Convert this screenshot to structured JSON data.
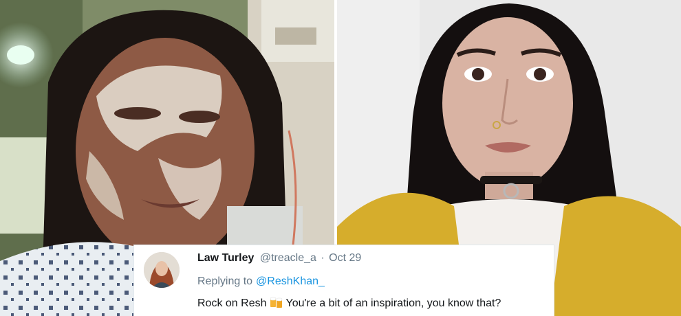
{
  "images": {
    "left": {
      "icon": "hospital-photo"
    },
    "right": {
      "icon": "selfie-photo"
    }
  },
  "tweet": {
    "display_name": "Law Turley",
    "handle": "@treacle_a",
    "separator": "·",
    "date": "Oct 29",
    "replying_to_label": "Replying to",
    "replying_to_handle": "@ReshKhan_",
    "text_before_emoji": "Rock on Resh",
    "emoji": "beer-mugs-icon",
    "text_after_emoji": "You're a bit of an inspiration, you know that?",
    "colors": {
      "name": "#14171a",
      "meta": "#657786",
      "link": "#1b95e0"
    }
  }
}
